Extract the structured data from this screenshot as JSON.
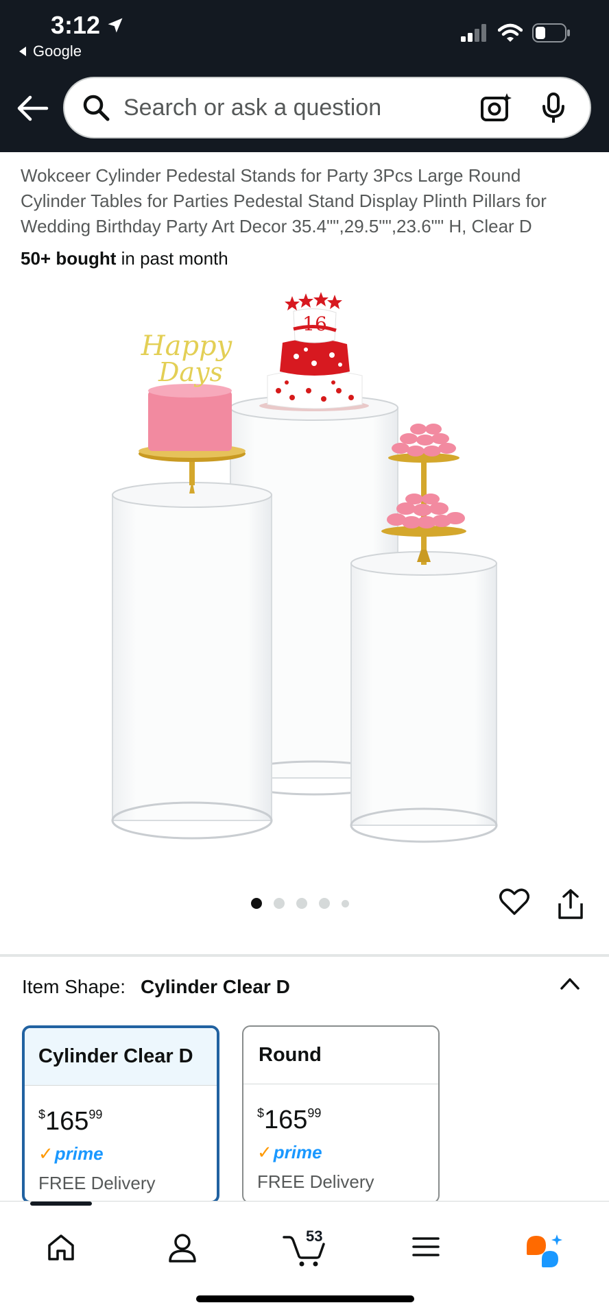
{
  "status_bar": {
    "time": "3:12",
    "back_app": "Google"
  },
  "search": {
    "placeholder": "Search or ask a question"
  },
  "product": {
    "title": "Wokceer Cylinder Pedestal Stands for Party 3Pcs Large Round Cylinder Tables for Parties Pedestal Stand Display Plinth Pillars for Wedding Birthday Party Art Decor 35.4\"\",29.5\"\",23.6\"\" H, Clear D",
    "bought_bold": "50+ bought",
    "bought_rest": " in past month",
    "image_topper_text": "Happy Days",
    "cake_number": "16"
  },
  "gallery": {
    "count": 5,
    "active_index": 0
  },
  "item_shape": {
    "label": "Item Shape:",
    "value": "Cylinder Clear D"
  },
  "options": [
    {
      "name": "Cylinder Clear D",
      "price_symbol": "$",
      "price_whole": "165",
      "price_fraction": "99",
      "prime_label": "prime",
      "delivery": "FREE Delivery",
      "selected": true
    },
    {
      "name": "Round",
      "price_symbol": "$",
      "price_whole": "165",
      "price_fraction": "99",
      "prime_label": "prime",
      "delivery": "FREE Delivery",
      "selected": false
    }
  ],
  "bottom_nav": {
    "cart_count": "53",
    "items": [
      "home-icon",
      "account-icon",
      "cart-icon",
      "menu-icon",
      "rufus-icon"
    ]
  },
  "colors": {
    "header_bg": "#131921",
    "selected_border": "#2162a1",
    "prime_blue": "#1a98ff",
    "prime_check": "#ff9900",
    "rufus_orange": "#ff6a00",
    "rufus_blue": "#1a98ff"
  }
}
